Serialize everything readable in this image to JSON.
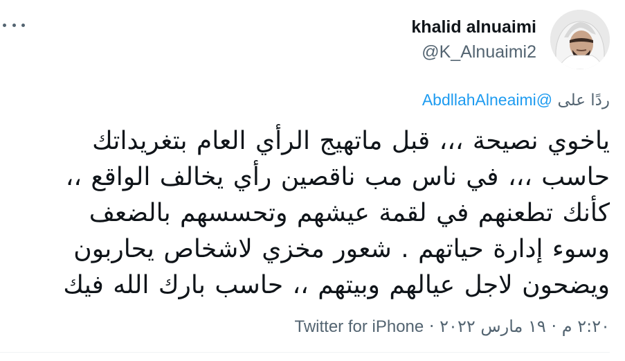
{
  "user": {
    "display_name": "khalid alnuaimi",
    "handle": "@K_Alnuaimi2"
  },
  "reply_to": {
    "prefix": "ردًا على",
    "mention": "@AbdllahAlneaimi"
  },
  "tweet": {
    "lines": [
      "ياخوي نصيحة ،،، قبل ماتهيج الرأي العام بتغريداتك",
      "حاسب ،،، في ناس مب ناقصين رأي يخالف الواقع ،،",
      "كأنك تطعنهم في لقمة عيشهم وتحسسهم بالضعف",
      "وسوء إدارة حياتهم . شعور مخزي لاشخاص يحاربون",
      "ويضحون لاجل عيالهم وبيتهم ،، حاسب بارك الله فيك"
    ]
  },
  "meta": {
    "time": "٢:٢٠ م",
    "separator": "·",
    "date": "١٩ مارس ٢٠٢٢",
    "source": "Twitter for iPhone"
  },
  "icons": {
    "more": "more-horizontal-icon"
  },
  "colors": {
    "primary_text": "#0f1419",
    "secondary_text": "#536471",
    "link": "#1d9bf0"
  }
}
